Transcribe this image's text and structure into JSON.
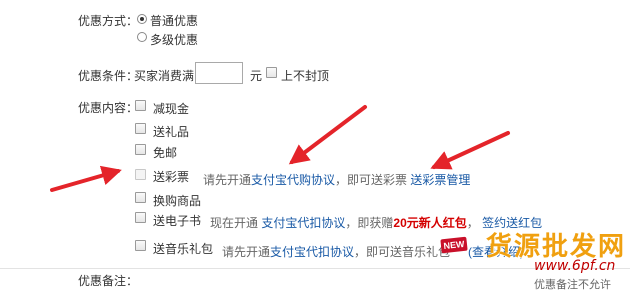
{
  "discount_type": {
    "label": "优惠方式：",
    "options": [
      {
        "label": "普通优惠",
        "selected": true
      },
      {
        "label": "多级优惠",
        "selected": false
      }
    ]
  },
  "discount_condition": {
    "label": "优惠条件：",
    "prefix": "买家消费满",
    "amount_value": "",
    "unit": "元",
    "no_cap_label": "上不封顶"
  },
  "discount_content": {
    "label": "优惠内容：",
    "items": [
      {
        "label": "减现金"
      },
      {
        "label": "送礼品"
      },
      {
        "label": "免邮"
      },
      {
        "label": "送彩票",
        "note_prefix": "请先开通",
        "link1": "支付宝代购协议",
        "note_mid": "，即可送彩票",
        "link2": "送彩票管理"
      },
      {
        "label": "换购商品"
      },
      {
        "label": "送电子书",
        "note_prefix": "现在开通",
        "link1": "支付宝代扣协议",
        "note_mid": "，即获赠",
        "highlight": "20元新人红包",
        "note_sep": "，",
        "link2": "签约送红包"
      },
      {
        "label": "送音乐礼包",
        "note_prefix": "请先开通",
        "link1": "支付宝代扣协议",
        "note_mid": "，即可送音乐礼包",
        "badge": "NEW",
        "link2": "(查看介绍)"
      }
    ]
  },
  "remark": {
    "label": "优惠备注：",
    "hint": "优惠备注不允许"
  },
  "watermark": {
    "text": "货源批发网",
    "url": "www.6pf.cn"
  },
  "colors": {
    "arrow": "#e4242a",
    "link": "#1a5aa6",
    "highlight": "#d40000"
  }
}
